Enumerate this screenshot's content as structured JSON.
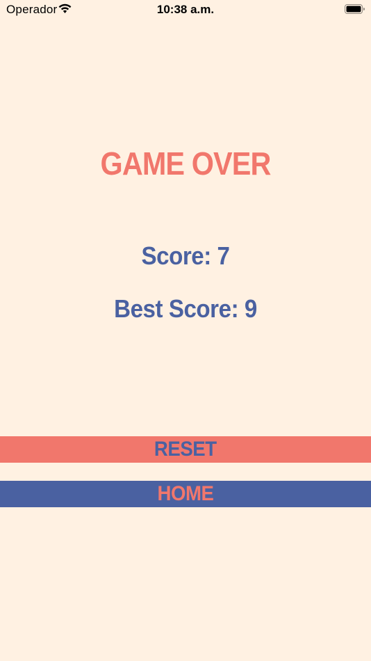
{
  "status_bar": {
    "carrier": "Operador",
    "time": "10:38 a.m.",
    "wifi_icon": "wifi-icon",
    "battery_icon": "battery-icon"
  },
  "game": {
    "title": "GAME OVER",
    "score_text": "Score: 7",
    "best_score_text": "Best Score: 9"
  },
  "buttons": {
    "reset_label": "RESET",
    "home_label": "HOME"
  },
  "colors": {
    "background": "#fff1e2",
    "coral": "#f1776c",
    "navy": "#4a61a1"
  }
}
